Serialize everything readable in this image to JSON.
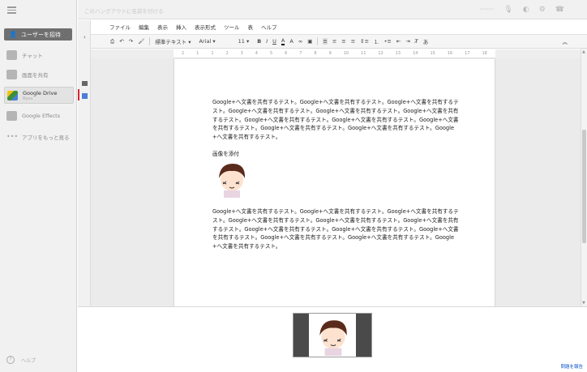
{
  "hangout": {
    "name_placeholder": "このハングアウトに名前を付ける",
    "invite_label": "ユーザーを招待",
    "apps": [
      {
        "label": "チャット",
        "icon": "chat-icon"
      },
      {
        "label": "画面を共有",
        "icon": "screenshare-icon"
      },
      {
        "label": "Google Drive",
        "sub": "Ryou",
        "icon": "google-drive-icon"
      },
      {
        "label": "Google Effects",
        "icon": "effects-icon"
      },
      {
        "label": "アプリをもっと見る",
        "icon": "more-icon"
      }
    ],
    "help_label": "ヘルプ",
    "report_label": "問題を報告"
  },
  "docs": {
    "menus": [
      "ファイル",
      "編集",
      "表示",
      "挿入",
      "表示形式",
      "ツール",
      "表",
      "ヘルプ"
    ],
    "toolbar": {
      "style": "標準テキスト",
      "font": "Arial",
      "size": "11",
      "bold": "B",
      "italic": "I",
      "underline": "U",
      "text_color": "A",
      "highlight": "A"
    },
    "ruler_marks": [
      "2",
      "1",
      "1",
      "2",
      "3",
      "4",
      "5",
      "6",
      "7",
      "8",
      "9",
      "10",
      "11",
      "12",
      "13",
      "14",
      "15",
      "16",
      "17",
      "18"
    ],
    "paragraph1": "Google+へ文書を共有するテスト。Google+へ文書を共有するテスト。Google+へ文書を共有するテスト。Google+へ文書を共有するテスト。Google+へ文書を共有するテスト。Google+へ文書を共有するテスト。Google+へ文書を共有するテスト。Google+へ文書を共有するテスト。Google+へ文書を共有するテスト。Google+へ文書を共有するテスト。Google+へ文書を共有するテスト。Google+へ文書を共有するテスト。",
    "image_label": "画像を添付",
    "paragraph2": "Google+へ文書を共有するテスト。Google+へ文書を共有するテスト。Google+へ文書を共有するテスト。Google+へ文書を共有するテスト。Google+へ文書を共有するテスト。Google+へ文書を共有するテスト。Google+へ文書を共有するテスト。Google+へ文書を共有するテスト。Google+へ文書を共有するテスト。Google+へ文書を共有するテスト。Google+へ文書を共有するテスト。Google+へ文書を共有するテスト。"
  },
  "colors": {
    "drive_blue": "#4a7fd6",
    "invite_bg": "#6f6f6f",
    "link_blue": "#1155cc"
  }
}
